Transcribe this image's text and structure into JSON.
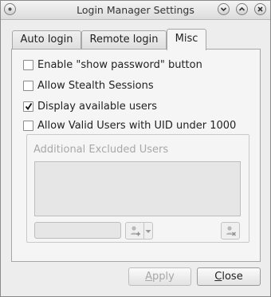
{
  "window": {
    "title": "Login Manager Settings"
  },
  "tabs": [
    {
      "label": "Auto login",
      "active": false
    },
    {
      "label": "Remote login",
      "active": false
    },
    {
      "label": "Misc",
      "active": true
    }
  ],
  "misc": {
    "options": [
      {
        "label": "Enable \"show password\" button",
        "checked": false
      },
      {
        "label": "Allow Stealth Sessions",
        "checked": false
      },
      {
        "label": "Display available users",
        "checked": true
      },
      {
        "label": "Allow Valid Users with UID under 1000",
        "checked": false
      }
    ],
    "excluded_group": {
      "title": "Additional Excluded Users",
      "enabled": false,
      "entry_value": ""
    }
  },
  "buttons": {
    "apply": {
      "first": "A",
      "rest": "pply",
      "enabled": false
    },
    "close": {
      "first": "C",
      "rest": "lose",
      "enabled": true
    }
  },
  "icons": {
    "menu": "window-menu-icon",
    "minimize": "minimize-icon",
    "maximize": "maximize-icon",
    "close": "close-icon",
    "add_user": "add-user-icon",
    "remove_user": "remove-user-icon",
    "dropdown": "chevron-down-icon",
    "check": "checkmark-icon"
  }
}
